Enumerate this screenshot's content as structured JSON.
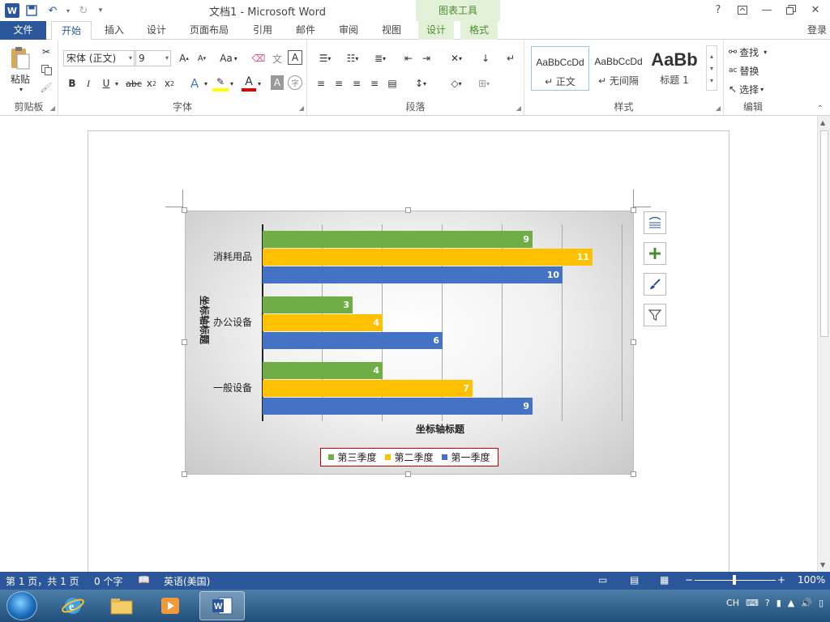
{
  "titlebar": {
    "document_title": "文档1 - Microsoft Word",
    "chart_tools_title": "图表工具",
    "help": "?",
    "minimize": "—"
  },
  "tabs": {
    "file": "文件",
    "home": "开始",
    "insert": "插入",
    "design": "设计",
    "page_layout": "页面布局",
    "references": "引用",
    "mailings": "邮件",
    "review": "审阅",
    "view": "视图",
    "chart_design": "设计",
    "chart_format": "格式",
    "login": "登录"
  },
  "ribbon": {
    "clipboard": {
      "label": "剪贴板",
      "paste": "粘贴"
    },
    "font": {
      "label": "字体",
      "font_name": "宋体 (正文)",
      "font_size": "9",
      "change_case": "Aa"
    },
    "paragraph": {
      "label": "段落"
    },
    "styles": {
      "label": "样式",
      "items": [
        {
          "preview": "AaBbCcDd",
          "name": "↵ 正文"
        },
        {
          "preview": "AaBbCcDd",
          "name": "↵ 无间隔"
        },
        {
          "preview": "AaBb",
          "name": "标题 1"
        }
      ]
    },
    "editing": {
      "label": "编辑",
      "find": "查找",
      "replace": "替换",
      "select": "选择"
    }
  },
  "chart_data": {
    "type": "bar",
    "orientation": "horizontal",
    "categories": [
      "消耗用品",
      "办公设备",
      "一般设备"
    ],
    "series": [
      {
        "name": "第三季度",
        "color": "#70ad47",
        "values": [
          9,
          3,
          4
        ]
      },
      {
        "name": "第二季度",
        "color": "#ffc000",
        "values": [
          11,
          4,
          7
        ]
      },
      {
        "name": "第一季度",
        "color": "#4472c4",
        "values": [
          10,
          6,
          9
        ]
      }
    ],
    "xlabel": "坐标轴标题",
    "ylabel": "坐标轴标题",
    "xlim": [
      0,
      12
    ],
    "grid": true,
    "legend": "bottom"
  },
  "statusbar": {
    "page": "第 1 页，共 1 页",
    "words": "0 个字",
    "language": "英语(美国)",
    "zoom": "100%"
  },
  "taskbar": {
    "tray_lang": "CH"
  }
}
